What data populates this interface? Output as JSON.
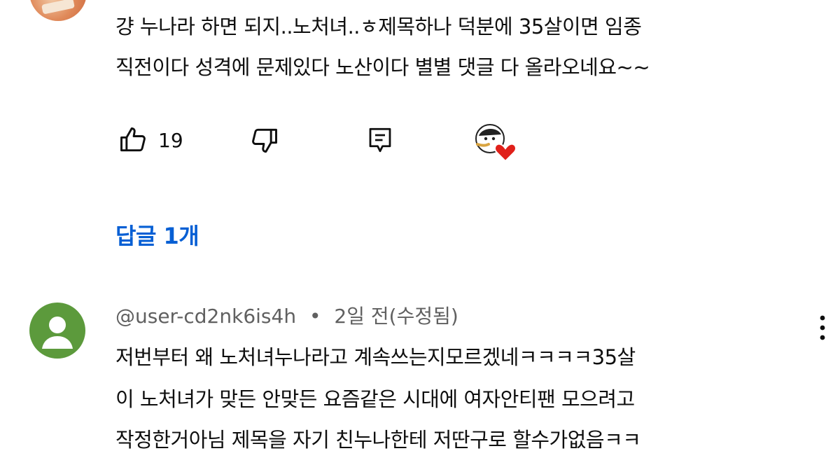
{
  "comment1": {
    "text_lines": [
      "걍 누나라 하면 되지..노처녀..ㅎ제목하나 덕분에 35살이면 임종",
      "직전이다 성격에 문제있다 노산이다 별별 댓글 다 올라오네요~~"
    ],
    "like_count": "19",
    "icons": {
      "like": "thumbs-up-icon",
      "dislike": "thumbs-down-icon",
      "reply": "reply-icon",
      "creator_heart": "creator-heart-icon"
    },
    "replies_label": "답글 1개"
  },
  "comment2": {
    "author": "@user-cd2nk6is4h",
    "separator": "•",
    "time": "2일 전(수정됨)",
    "text_lines": [
      "저번부터 왜 노처녀누나라고 계속쓰는지모르겠네ㅋㅋㅋㅋ35살",
      "이 노처녀가 맞든 안맞든 요즘같은 시대에 여자안티팬 모으려고",
      "작정한거아님 제목을 자기 친누나한테 저딴구로 할수가없음ㅋㅋ"
    ],
    "icons": {
      "avatar": "default-avatar-icon",
      "menu": "more-vert-icon"
    }
  },
  "colors": {
    "link": "#065fd4",
    "meta": "#606060",
    "text": "#0f0f0f",
    "avatar_green": "#5c9a3c",
    "heart": "#e0201a"
  }
}
